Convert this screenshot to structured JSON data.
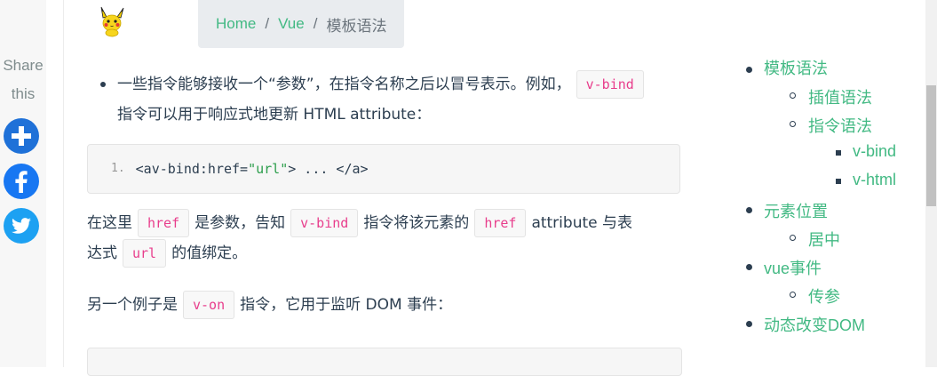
{
  "share": {
    "label_line1": "Share",
    "label_line2": "this",
    "buttons": [
      {
        "name": "addthis-plus",
        "color": "#1f71d8"
      },
      {
        "name": "facebook",
        "color": "#1877f2"
      },
      {
        "name": "twitter",
        "color": "#1da1f2"
      }
    ]
  },
  "logo": {
    "icon": "pikachu-logo-icon"
  },
  "breadcrumb": {
    "items": [
      {
        "label": "Home"
      },
      {
        "label": "Vue"
      }
    ],
    "separator": "/",
    "current": "模板语法"
  },
  "content": {
    "bullet1": {
      "text_a": "一些指令能够接收一个“参数”，在指令名称之后以冒号表示。例如，",
      "code_a": "v-bind",
      "text_b": "指令可以用于响应式地更新 HTML attribute："
    },
    "code1": {
      "line_number": "1.",
      "tag_open": "<a",
      "attr": " v-bind:href=",
      "string": "\"url\"",
      "rest": "> ... </a>"
    },
    "para1": {
      "t1": "在这里",
      "c1": "href",
      "t2": "是参数，告知",
      "c2": "v-bind",
      "t3": "指令将该元素的",
      "c3": "href",
      "t4": "attribute 与表",
      "t5": "达式",
      "c4": "url",
      "t6": "的值绑定。"
    },
    "para2": {
      "t1": "另一个例子是",
      "c1": "v-on",
      "t2": "指令，它用于监听 DOM 事件："
    }
  },
  "toc": {
    "items": [
      {
        "label": "模板语法",
        "level": 1
      },
      {
        "label": "插值语法",
        "level": 2
      },
      {
        "label": "指令语法",
        "level": 2
      },
      {
        "label": "v-bind",
        "level": 3
      },
      {
        "label": "v-html",
        "level": 3
      },
      {
        "label": "元素位置",
        "level": 1
      },
      {
        "label": "居中",
        "level": 2
      },
      {
        "label": "vue事件",
        "level": 1
      },
      {
        "label": "传参",
        "level": 2
      },
      {
        "label": "动态改变DOM",
        "level": 1
      }
    ]
  },
  "colors": {
    "accent": "#42b983",
    "text": "#2c3e50",
    "code_inline": "#e83e8c"
  }
}
